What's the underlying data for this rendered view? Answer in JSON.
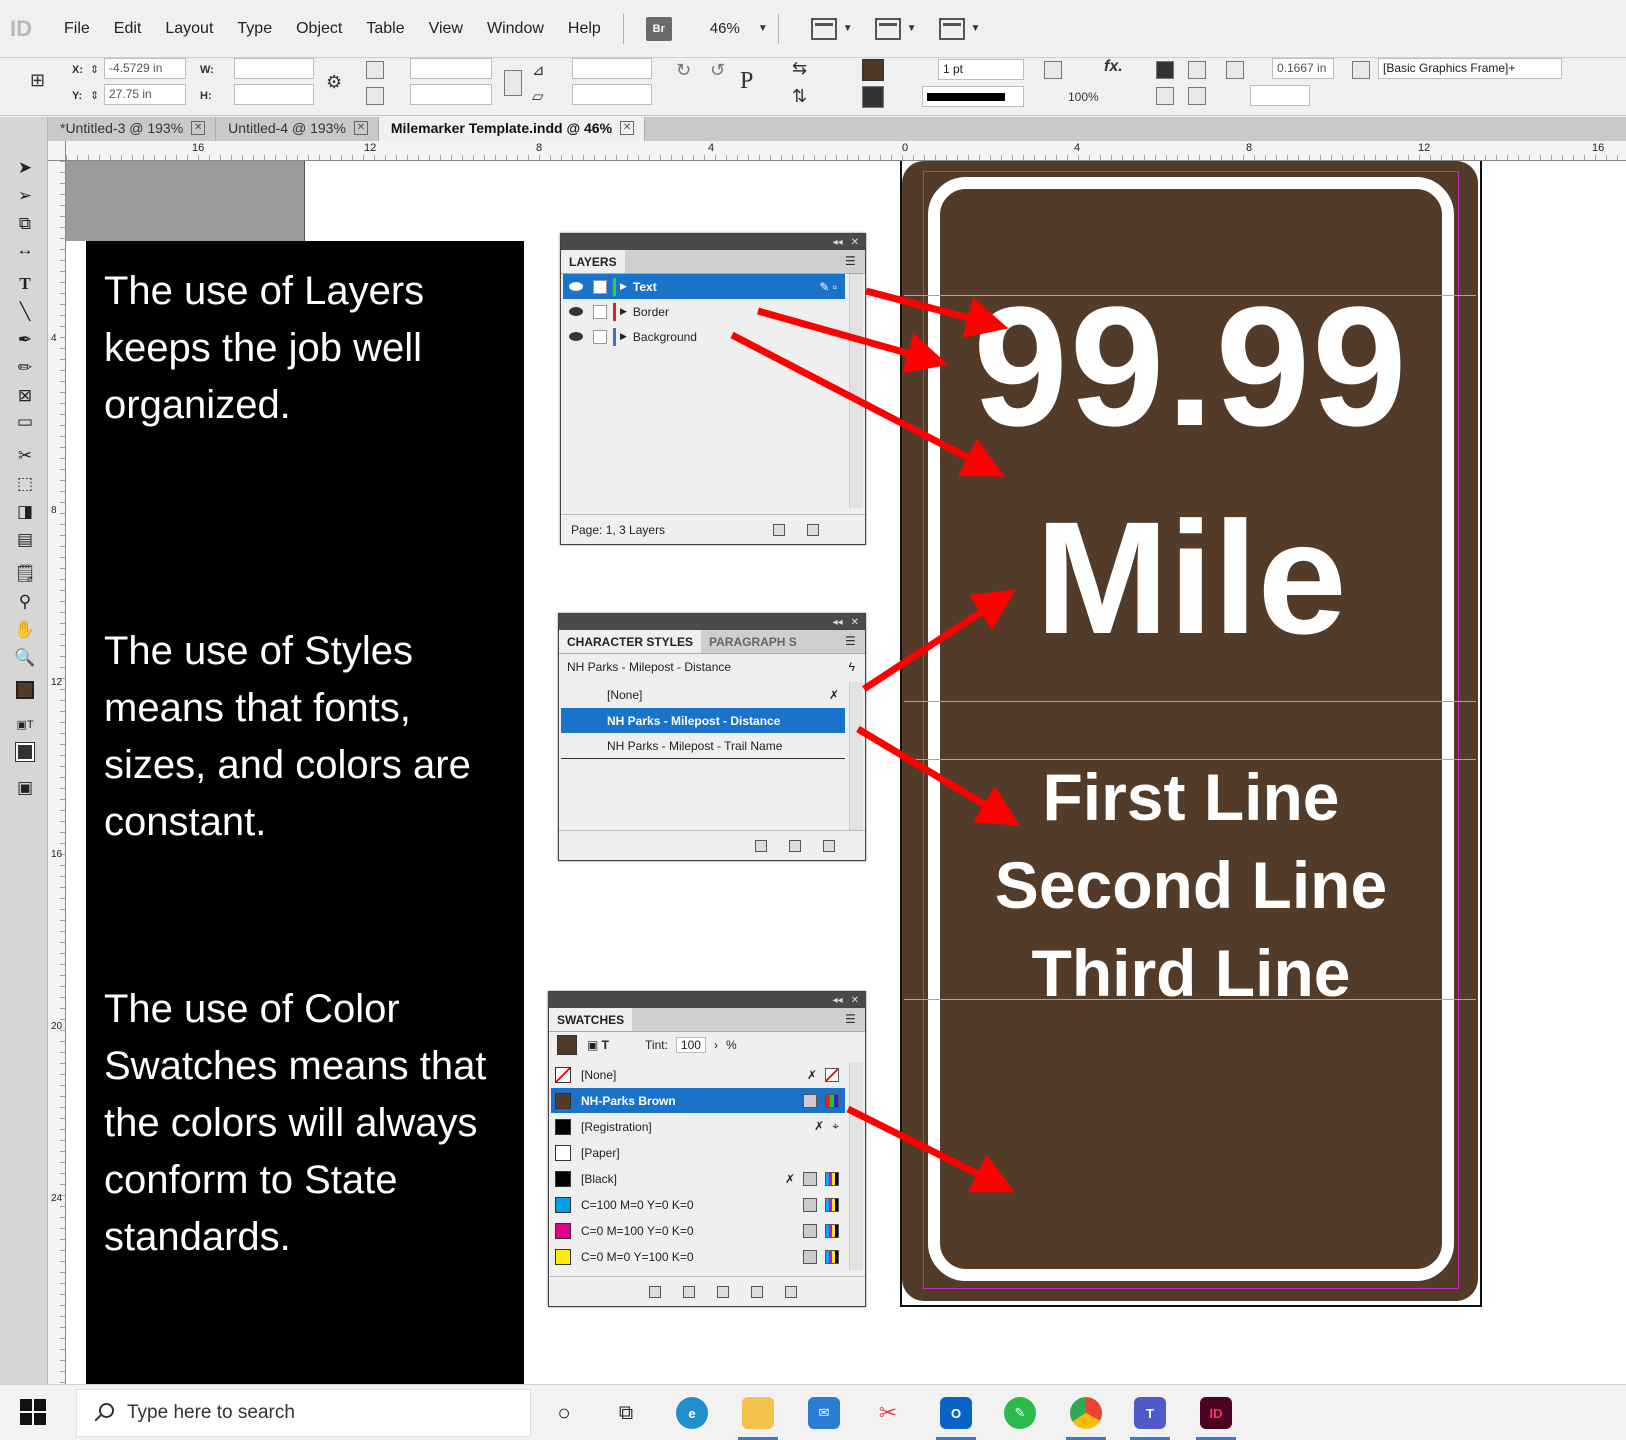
{
  "menu": {
    "items": [
      "File",
      "Edit",
      "Layout",
      "Type",
      "Object",
      "Table",
      "View",
      "Window",
      "Help"
    ],
    "bridge_label": "Br",
    "zoom": "46%"
  },
  "control": {
    "x_label": "X:",
    "x_value": "-4.5729 in",
    "y_label": "Y:",
    "y_value": "27.75 in",
    "w_label": "W:",
    "h_label": "H:",
    "stroke_weight": "1 pt",
    "opacity": "100%",
    "fitting": "0.1667 in",
    "object_style": "[Basic Graphics Frame]+"
  },
  "tabs": [
    {
      "label": "*Untitled-3 @ 193%",
      "active": false
    },
    {
      "label": "Untitled-4 @ 193%",
      "active": false
    },
    {
      "label": "Milemarker Template.indd @ 46%",
      "active": true
    }
  ],
  "ruler": {
    "h_marks": [
      "16",
      "12",
      "8",
      "4",
      "0",
      "4",
      "8",
      "12",
      "16"
    ],
    "v_marks": [
      "4",
      "8",
      "12",
      "16",
      "20",
      "24"
    ]
  },
  "notes": [
    "The use of Layers keeps the job well organized.",
    "The use of Styles means that fonts, sizes, and colors are constant.",
    "The use of Color Swatches means that the colors will always conform to State standards."
  ],
  "layers_panel": {
    "tab": "LAYERS",
    "layers": [
      {
        "name": "Text",
        "color": "#2ad42a",
        "selected": true
      },
      {
        "name": "Border",
        "color": "#e02020",
        "selected": false
      },
      {
        "name": "Background",
        "color": "#3a6fd8",
        "selected": false
      }
    ],
    "footer": "Page: 1, 3 Layers"
  },
  "character_styles_panel": {
    "tab": "CHARACTER STYLES",
    "tab2": "PARAGRAPH S",
    "current": "NH Parks - Milepost - Distance",
    "styles": [
      {
        "name": "[None]",
        "selected": false
      },
      {
        "name": "NH Parks - Milepost - Distance",
        "selected": true
      },
      {
        "name": "NH Parks - Milepost - Trail Name",
        "selected": false
      }
    ]
  },
  "swatches_panel": {
    "tab": "SWATCHES",
    "tint_label": "Tint:",
    "tint_value": "100",
    "tint_unit": "%",
    "swatches": [
      {
        "name": "[None]",
        "color": "#ffffff",
        "selected": false
      },
      {
        "name": "NH-Parks Brown",
        "color": "#533b2a",
        "selected": true
      },
      {
        "name": "[Registration]",
        "color": "#000000",
        "selected": false
      },
      {
        "name": "[Paper]",
        "color": "#ffffff",
        "selected": false
      },
      {
        "name": "[Black]",
        "color": "#000000",
        "selected": false
      },
      {
        "name": "C=100 M=0 Y=0 K=0",
        "color": "#00a0e6",
        "selected": false
      },
      {
        "name": "C=0 M=100 Y=0 K=0",
        "color": "#e0008a",
        "selected": false
      },
      {
        "name": "C=0 M=0 Y=100 K=0",
        "color": "#ffee00",
        "selected": false
      }
    ]
  },
  "sign": {
    "distance": "99.99",
    "unit": "Mile",
    "line1": "First Line",
    "line2": "Second Line",
    "line3": "Third Line",
    "bg_color": "#533b2a"
  },
  "taskbar": {
    "search_placeholder": "Type here to search",
    "indesign_label": "ID"
  }
}
